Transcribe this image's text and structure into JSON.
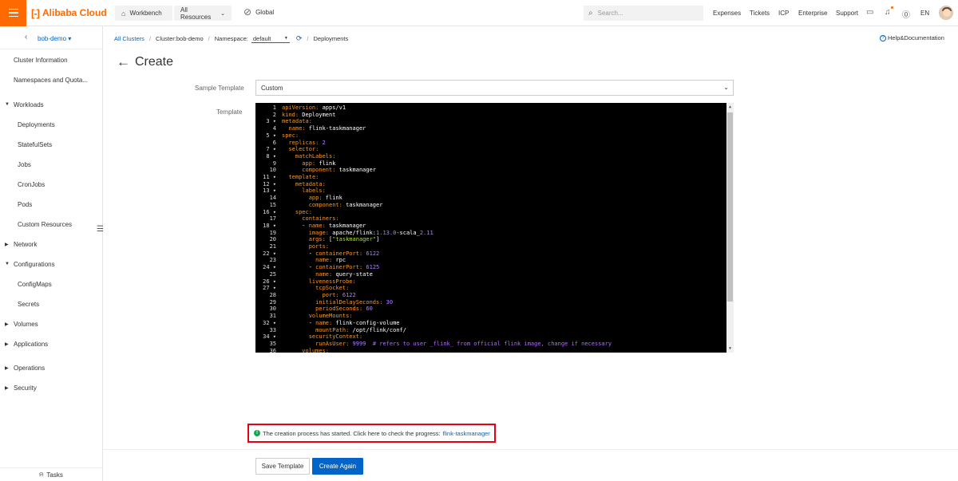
{
  "topbar": {
    "brand": "Alibaba Cloud",
    "brand_mark": "[-]",
    "workbench": "Workbench",
    "resources": "All Resources",
    "region": "Global",
    "search_placeholder": "Search...",
    "nav": [
      "Expenses",
      "Tickets",
      "ICP",
      "Enterprise",
      "Support"
    ],
    "language": "EN",
    "accent_color": "#ff6a00"
  },
  "sidebar": {
    "cluster_name": "bob-demo ▾",
    "items": [
      {
        "label": "Cluster Information"
      },
      {
        "label": "Namespaces and Quota..."
      },
      {
        "label": "Workloads"
      },
      {
        "label": "Deployments"
      },
      {
        "label": "StatefulSets"
      },
      {
        "label": "Jobs"
      },
      {
        "label": "CronJobs"
      },
      {
        "label": "Pods"
      },
      {
        "label": "Custom Resources"
      },
      {
        "label": "Network"
      },
      {
        "label": "Configurations"
      },
      {
        "label": "ConfigMaps"
      },
      {
        "label": "Secrets"
      },
      {
        "label": "Volumes"
      },
      {
        "label": "Applications"
      },
      {
        "label": "Operations"
      },
      {
        "label": "Security"
      }
    ],
    "tasks": "Tasks"
  },
  "breadcrumb": {
    "all_clusters": "All Clusters",
    "cluster": "Cluster:bob-demo",
    "namespace_label": "Namespace:",
    "namespace_value": "default",
    "deployments": "Deployments"
  },
  "help": "Help&Documentation",
  "page": {
    "title": "Create",
    "sample_template_label": "Sample Template",
    "sample_template_value": "Custom",
    "template_label": "Template"
  },
  "editor": {
    "line_numbers": [
      "1",
      "2",
      "3",
      "4",
      "5",
      "6",
      "7",
      "8",
      "9",
      "10",
      "11",
      "12",
      "13",
      "14",
      "15",
      "16",
      "17",
      "18",
      "19",
      "20",
      "21",
      "22",
      "23",
      "24",
      "25",
      "26",
      "27",
      "28",
      "29",
      "30",
      "31",
      "32",
      "33",
      "34",
      "35",
      "36"
    ]
  },
  "notice": {
    "text": "The creation process has started. Click here to check the progress:",
    "link": "flink-taskmanager",
    "status_color": "#14a656"
  },
  "buttons": {
    "save_template": "Save Template",
    "create_again": "Create Again"
  }
}
